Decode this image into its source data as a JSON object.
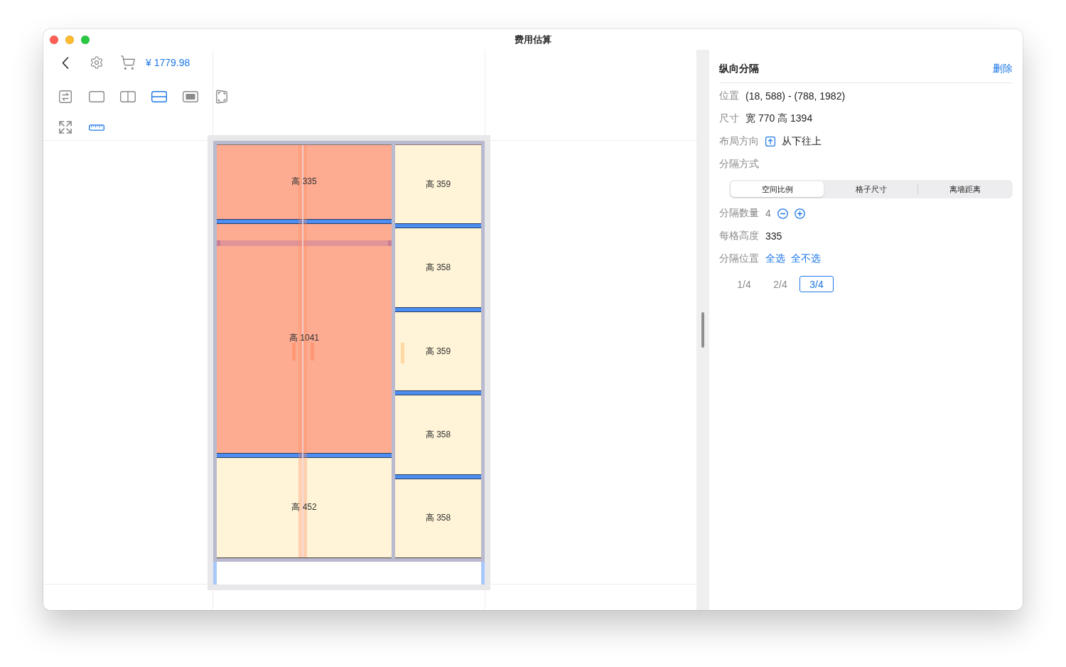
{
  "window": {
    "title": "费用估算"
  },
  "toolbar": {
    "price": "¥ 1779.98",
    "tool_rows": [
      [
        {
          "kind": "swap",
          "selected": false
        },
        {
          "kind": "panel",
          "selected": false
        },
        {
          "kind": "split-columns",
          "selected": false
        },
        {
          "kind": "split-rows",
          "selected": true
        },
        {
          "kind": "inset",
          "selected": false
        },
        {
          "kind": "perspective",
          "selected": false
        }
      ],
      [
        {
          "kind": "expand",
          "selected": false
        },
        {
          "kind": "ruler",
          "selected": true
        }
      ]
    ]
  },
  "cabinet": {
    "columns": [
      {
        "kind": "double",
        "cells": [
          {
            "label": "高 335",
            "selected": true,
            "rod": false
          },
          {
            "label": "高 1041",
            "selected": true,
            "rod": true
          },
          {
            "label": "高 452",
            "selected": false,
            "rod": false
          }
        ]
      },
      {
        "kind": "single",
        "cells": [
          {
            "label": "高 359",
            "selected": false,
            "rod": false
          },
          {
            "label": "高 358",
            "selected": false,
            "rod": false
          },
          {
            "label": "高 359",
            "selected": false,
            "rod": false
          },
          {
            "label": "高 358",
            "selected": false,
            "rod": false
          },
          {
            "label": "高 358",
            "selected": false,
            "rod": false
          }
        ]
      }
    ]
  },
  "inspector": {
    "title": "纵向分隔",
    "delete": "删除",
    "rows": [
      {
        "kind": "text",
        "label": "位置",
        "value": "(18, 588) - (788, 1982)"
      },
      {
        "kind": "text",
        "label": "尺寸",
        "value": "宽 770 高 1394"
      },
      {
        "kind": "direction",
        "label": "布局方向",
        "value": "从下往上"
      },
      {
        "kind": "heading",
        "label": "分隔方式"
      },
      {
        "kind": "segments",
        "segments": [
          {
            "label": "空间比例",
            "selected": true
          },
          {
            "label": "格子尺寸",
            "selected": false
          },
          {
            "label": "离墙距离",
            "selected": false
          }
        ]
      },
      {
        "kind": "count",
        "label": "分隔数量",
        "value": "4"
      },
      {
        "kind": "text",
        "label": "每格高度",
        "value": "335"
      },
      {
        "kind": "links",
        "label": "分隔位置",
        "links": [
          "全选",
          "全不选"
        ]
      },
      {
        "kind": "chips",
        "chips": [
          {
            "label": "1/4",
            "selected": false
          },
          {
            "label": "2/4",
            "selected": false
          },
          {
            "label": "3/4",
            "selected": true
          }
        ]
      }
    ]
  }
}
